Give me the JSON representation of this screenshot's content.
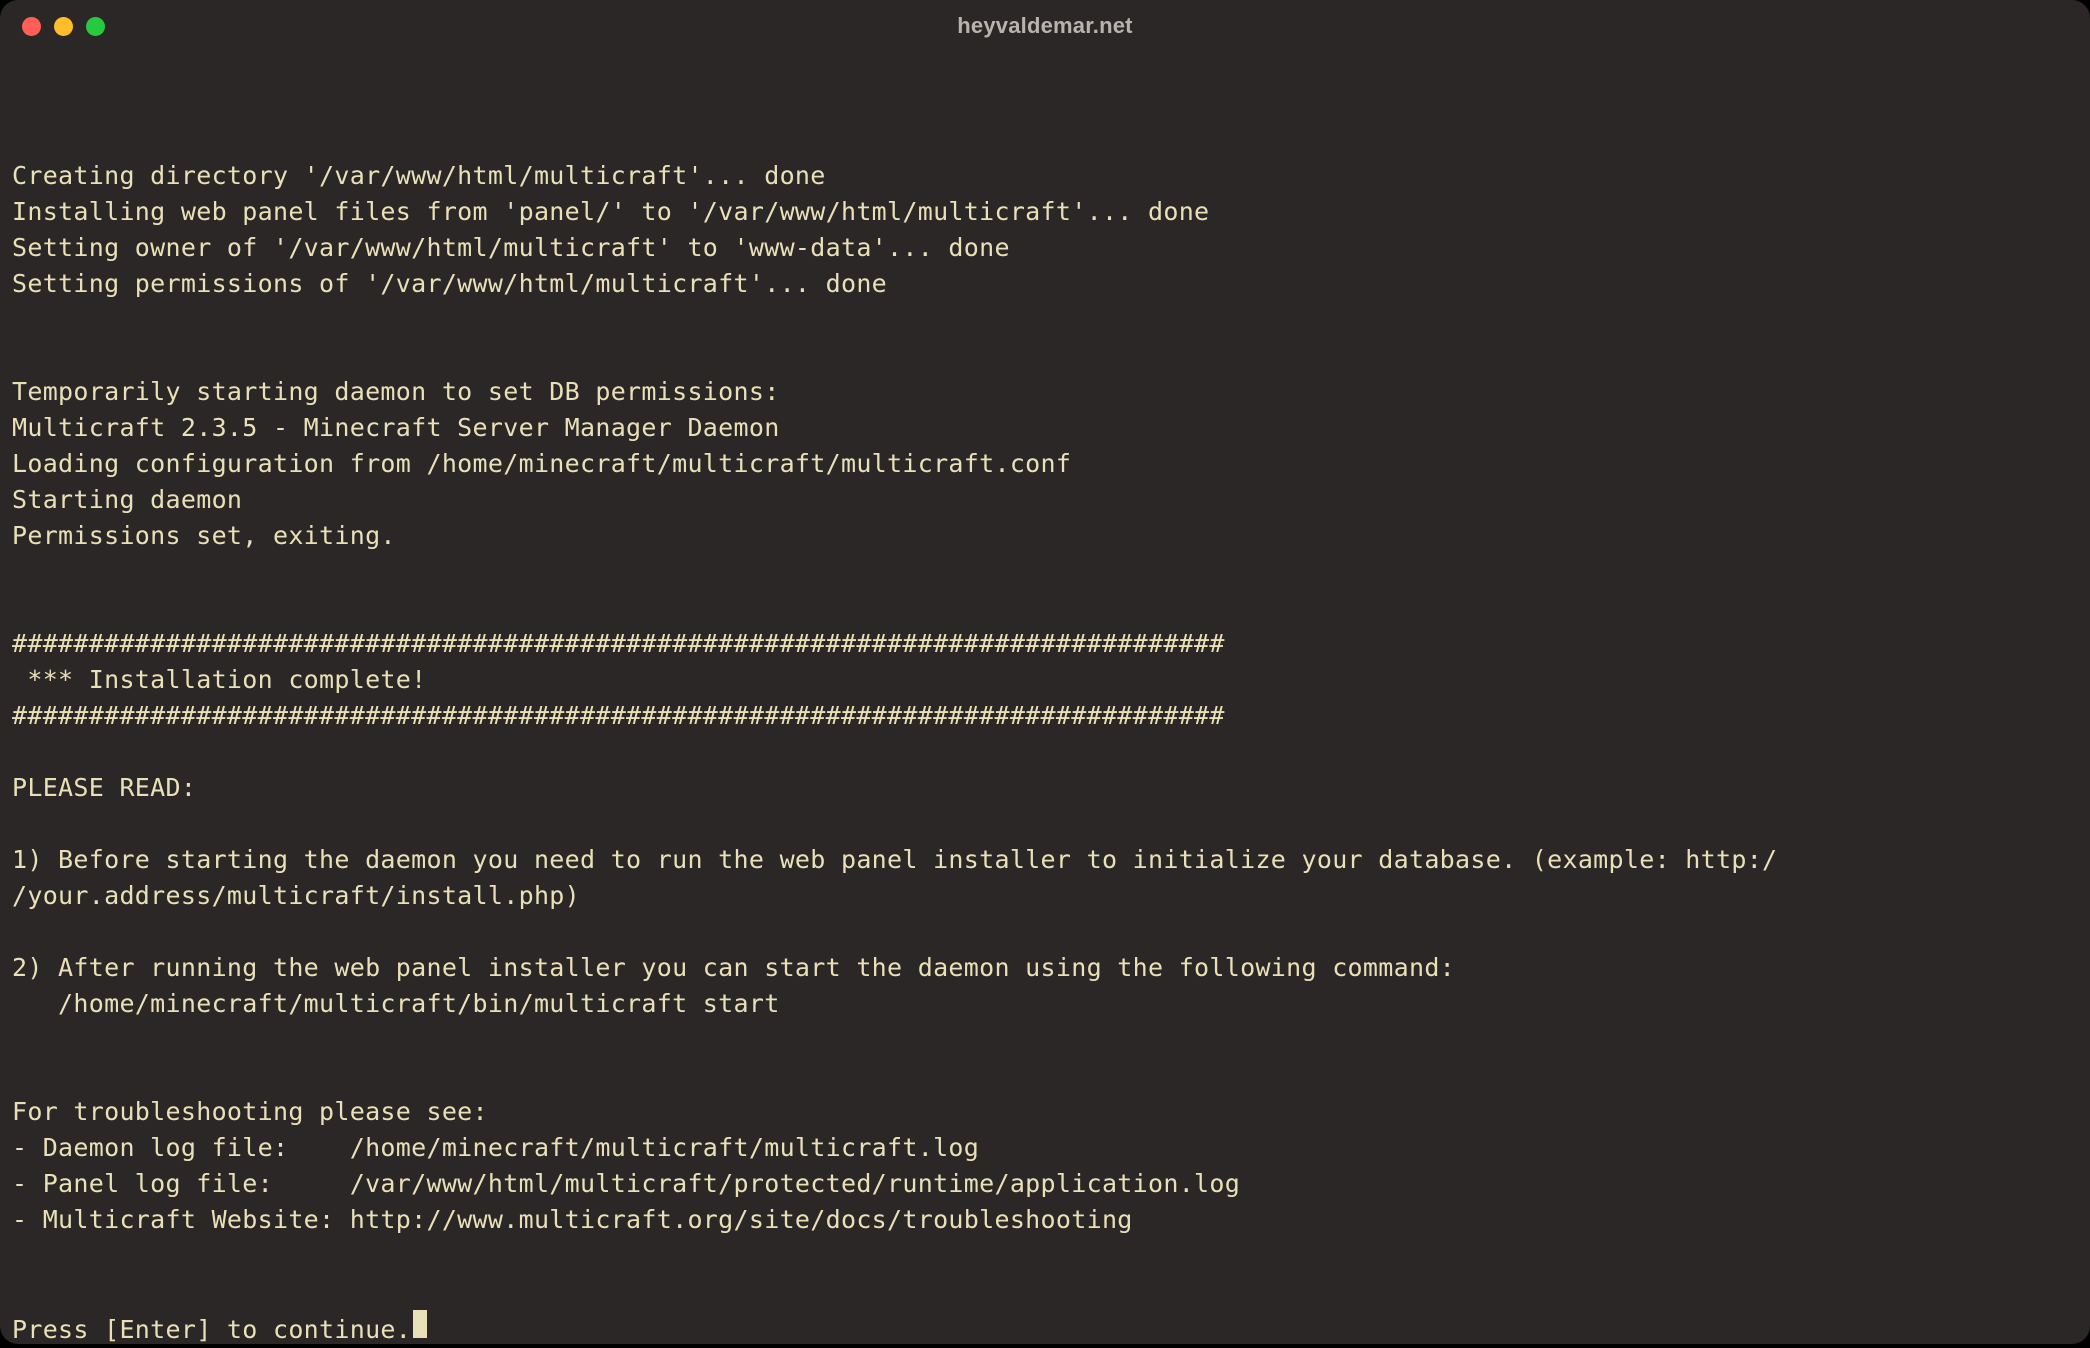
{
  "window": {
    "title": "heyvaldemar.net"
  },
  "terminal": {
    "lines": [
      "",
      "Creating directory '/var/www/html/multicraft'... done",
      "Installing web panel files from 'panel/' to '/var/www/html/multicraft'... done",
      "Setting owner of '/var/www/html/multicraft' to 'www-data'... done",
      "Setting permissions of '/var/www/html/multicraft'... done",
      "",
      "",
      "Temporarily starting daemon to set DB permissions:",
      "Multicraft 2.3.5 - Minecraft Server Manager Daemon",
      "Loading configuration from /home/minecraft/multicraft/multicraft.conf",
      "Starting daemon",
      "Permissions set, exiting.",
      "",
      "",
      "###############################################################################",
      " *** Installation complete!",
      "###############################################################################",
      "",
      "PLEASE READ:",
      "",
      "1) Before starting the daemon you need to run the web panel installer to initialize your database. (example: http:/",
      "/your.address/multicraft/install.php)",
      "",
      "2) After running the web panel installer you can start the daemon using the following command:",
      "   /home/minecraft/multicraft/bin/multicraft start",
      "",
      "",
      "For troubleshooting please see:",
      "- Daemon log file:    /home/minecraft/multicraft/multicraft.log",
      "- Panel log file:     /var/www/html/multicraft/protected/runtime/application.log",
      "- Multicraft Website: http://www.multicraft.org/site/docs/troubleshooting",
      "",
      ""
    ],
    "prompt": "Press [Enter] to continue."
  },
  "colors": {
    "bg": "#2a2726",
    "fg": "#e9e0b8",
    "title": "#b8b4ad",
    "red": "#ff5f56",
    "yellow": "#ffbd2e",
    "green": "#27c93f"
  }
}
